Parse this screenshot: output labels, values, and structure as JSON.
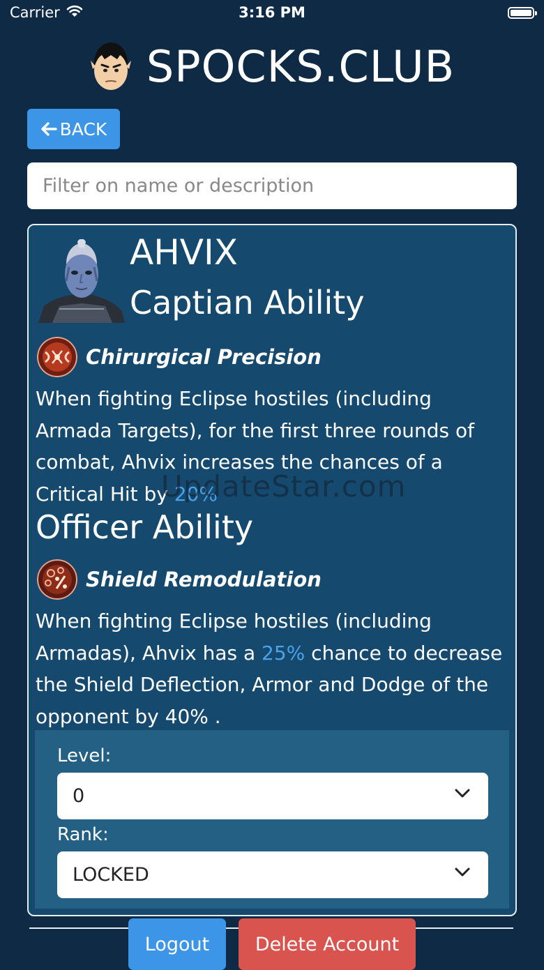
{
  "status_bar": {
    "carrier": "Carrier",
    "time": "3:16 PM"
  },
  "header": {
    "title": "SPOCKS.CLUB"
  },
  "back_button": {
    "label": "BACK"
  },
  "filter": {
    "placeholder": "Filter on name or description",
    "value": ""
  },
  "officer": {
    "name": "AHVIX",
    "captain_heading": "Captian Ability",
    "captain_ability": {
      "name": "Chirurgical Precision",
      "text": "When fighting Eclipse hostiles (including Armada Targets), for the first three rounds of combat, Ahvix increases the chances of a Critical Hit by",
      "value": "20%"
    },
    "officer_heading": "Officer Ability",
    "officer_ability": {
      "name": "Shield Remodulation",
      "text_before": "When fighting Eclipse hostiles (including Armadas), Ahvix has a",
      "value": "25%",
      "text_after": "chance to decrease the Shield Deflection, Armor and Dodge of the opponent by 40% ."
    }
  },
  "watermark": "UpdateStar.com",
  "form": {
    "level_label": "Level:",
    "level_value": "0",
    "rank_label": "Rank:",
    "rank_value": "LOCKED"
  },
  "footer": {
    "logout_label": "Logout",
    "delete_label": "Delete Account"
  },
  "colors": {
    "background": "#0f2a44",
    "card": "#16496e",
    "accent": "#3d95e7",
    "highlight": "#4aa3e8",
    "danger": "#d9534f"
  }
}
